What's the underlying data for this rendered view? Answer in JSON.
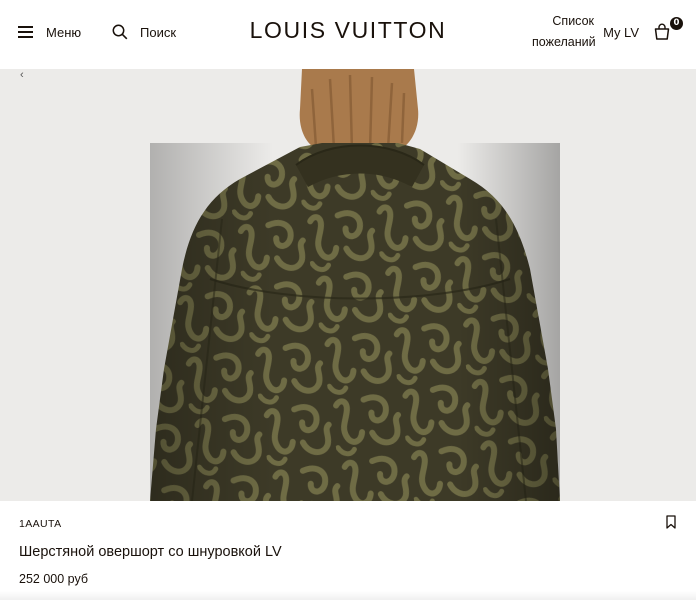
{
  "header": {
    "menu_label": "Меню",
    "search_label": "Поиск",
    "logo": "LOUIS VUITTON",
    "wishlist_line1": "Список",
    "wishlist_line2": "пожеланий",
    "mylv_label": "My LV",
    "bag_count": "0"
  },
  "hero": {
    "image": "product-photo-wool-overshirt-back-view",
    "back_glyph": "‹"
  },
  "product": {
    "sku": "1AAUTA",
    "title": "Шерстяной овершорт со шнуровкой LV",
    "price": "252 000 руб"
  },
  "colors": {
    "text": "#19110b",
    "background": "#ffffff",
    "hero_background": "#ecebe9",
    "jacket_base": "#3d3a27",
    "jacket_pattern": "#6f6c45",
    "hair": "#a97a4c"
  }
}
